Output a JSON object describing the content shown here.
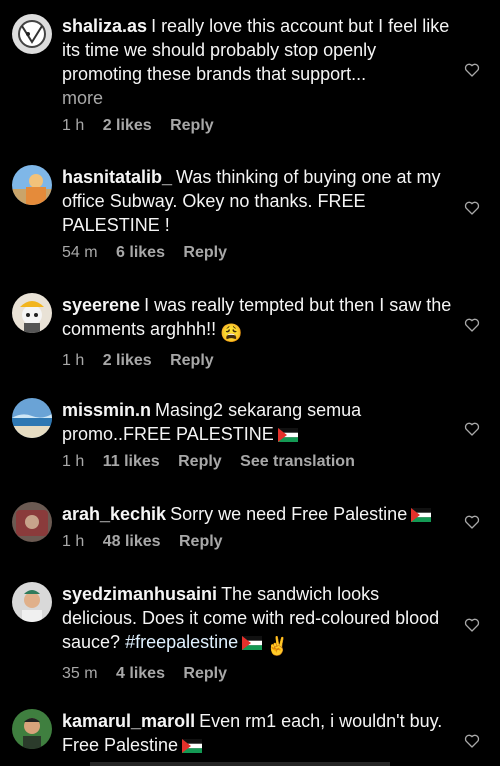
{
  "comments": [
    {
      "username": "shaliza.as",
      "text": "I really love this account but I feel like its time we should probably stop openly promoting these brands that support...",
      "more": "more",
      "time": "1 h",
      "likes": "2 likes",
      "reply": "Reply"
    },
    {
      "username": "hasnitatalib_",
      "text": "Was thinking of buying one at my office Subway. Okey no thanks. FREE PALESTINE !",
      "time": "54 m",
      "likes": "6 likes",
      "reply": "Reply"
    },
    {
      "username": "syeerene",
      "text": "I was really tempted but then I saw the comments arghhh!!",
      "emoji": "😩",
      "time": "1 h",
      "likes": "2 likes",
      "reply": "Reply"
    },
    {
      "username": "missmin.n",
      "text": "Masing2 sekarang semua promo..FREE PALESTINE",
      "time": "1 h",
      "likes": "11 likes",
      "reply": "Reply",
      "translate": "See translation"
    },
    {
      "username": "arah_kechik",
      "text": "Sorry we need Free Palestine",
      "time": "1 h",
      "likes": "48 likes",
      "reply": "Reply"
    },
    {
      "username": "syedzimanhusaini",
      "text": "The sandwich looks delicious. Does it come with red-coloured blood sauce?",
      "hashtag": "#freepalestine",
      "emoji": "✌",
      "time": "35 m",
      "likes": "4 likes",
      "reply": "Reply"
    },
    {
      "username": "kamarul_maroll",
      "text": "Even rm1 each, i wouldn't buy. Free Palestine"
    }
  ],
  "colors": {
    "background": "#000000",
    "text": "#f5f5f5",
    "secondary": "#a8a8a8",
    "hashtag": "#e0f1ff"
  },
  "icons": {
    "like": "heart-outline-icon",
    "flag": "palestine-flag-icon"
  }
}
